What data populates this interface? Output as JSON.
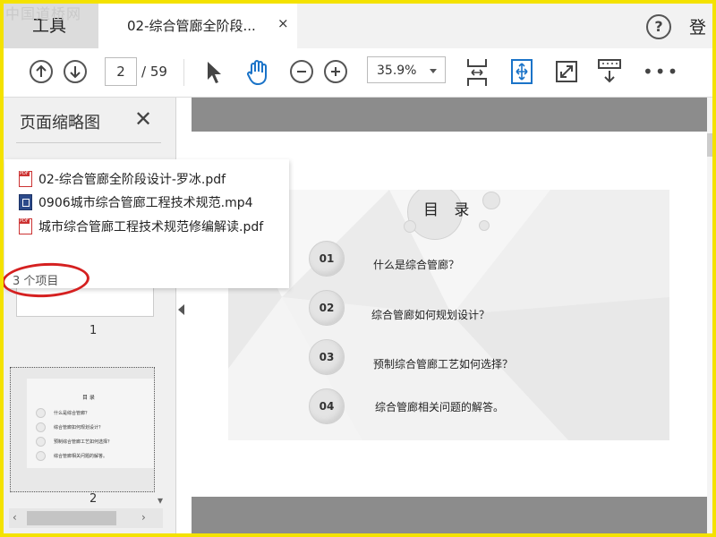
{
  "watermark": "中国道桥网",
  "tabs": {
    "tools_label": "工具",
    "doc_label": "02-综合管廊全阶段...",
    "close_glyph": "×",
    "help_glyph": "?",
    "login_label": "登"
  },
  "toolbar": {
    "current_page": "2",
    "total_pages": "/ 59",
    "zoom": "35.9%"
  },
  "thumbnail_panel": {
    "title": "页面缩略图",
    "close_glyph": "✕",
    "page_labels": [
      "1",
      "2"
    ]
  },
  "slide": {
    "title": "目 录",
    "items": [
      {
        "num": "01",
        "text": "什么是综合管廊？"
      },
      {
        "num": "02",
        "text": "综合管廊如何规划设计？"
      },
      {
        "num": "03",
        "text": "预制综合管廊工艺如何选择？"
      },
      {
        "num": "04",
        "text": "综合管廊相关问题的解答。"
      }
    ]
  },
  "popup": {
    "files": [
      {
        "name": "02-综合管廊全阶段设计-罗冰.pdf",
        "type": "pdf"
      },
      {
        "name": "0906城市综合管廊工程技术规范.mp4",
        "type": "mp4"
      },
      {
        "name": "城市综合管廊工程技术规范修编解读.pdf",
        "type": "pdf"
      }
    ],
    "count": "3 个项目"
  },
  "colors": {
    "frame": "#f4e200",
    "highlight_oval": "#d52020",
    "accent_blue": "#1a73c8"
  }
}
